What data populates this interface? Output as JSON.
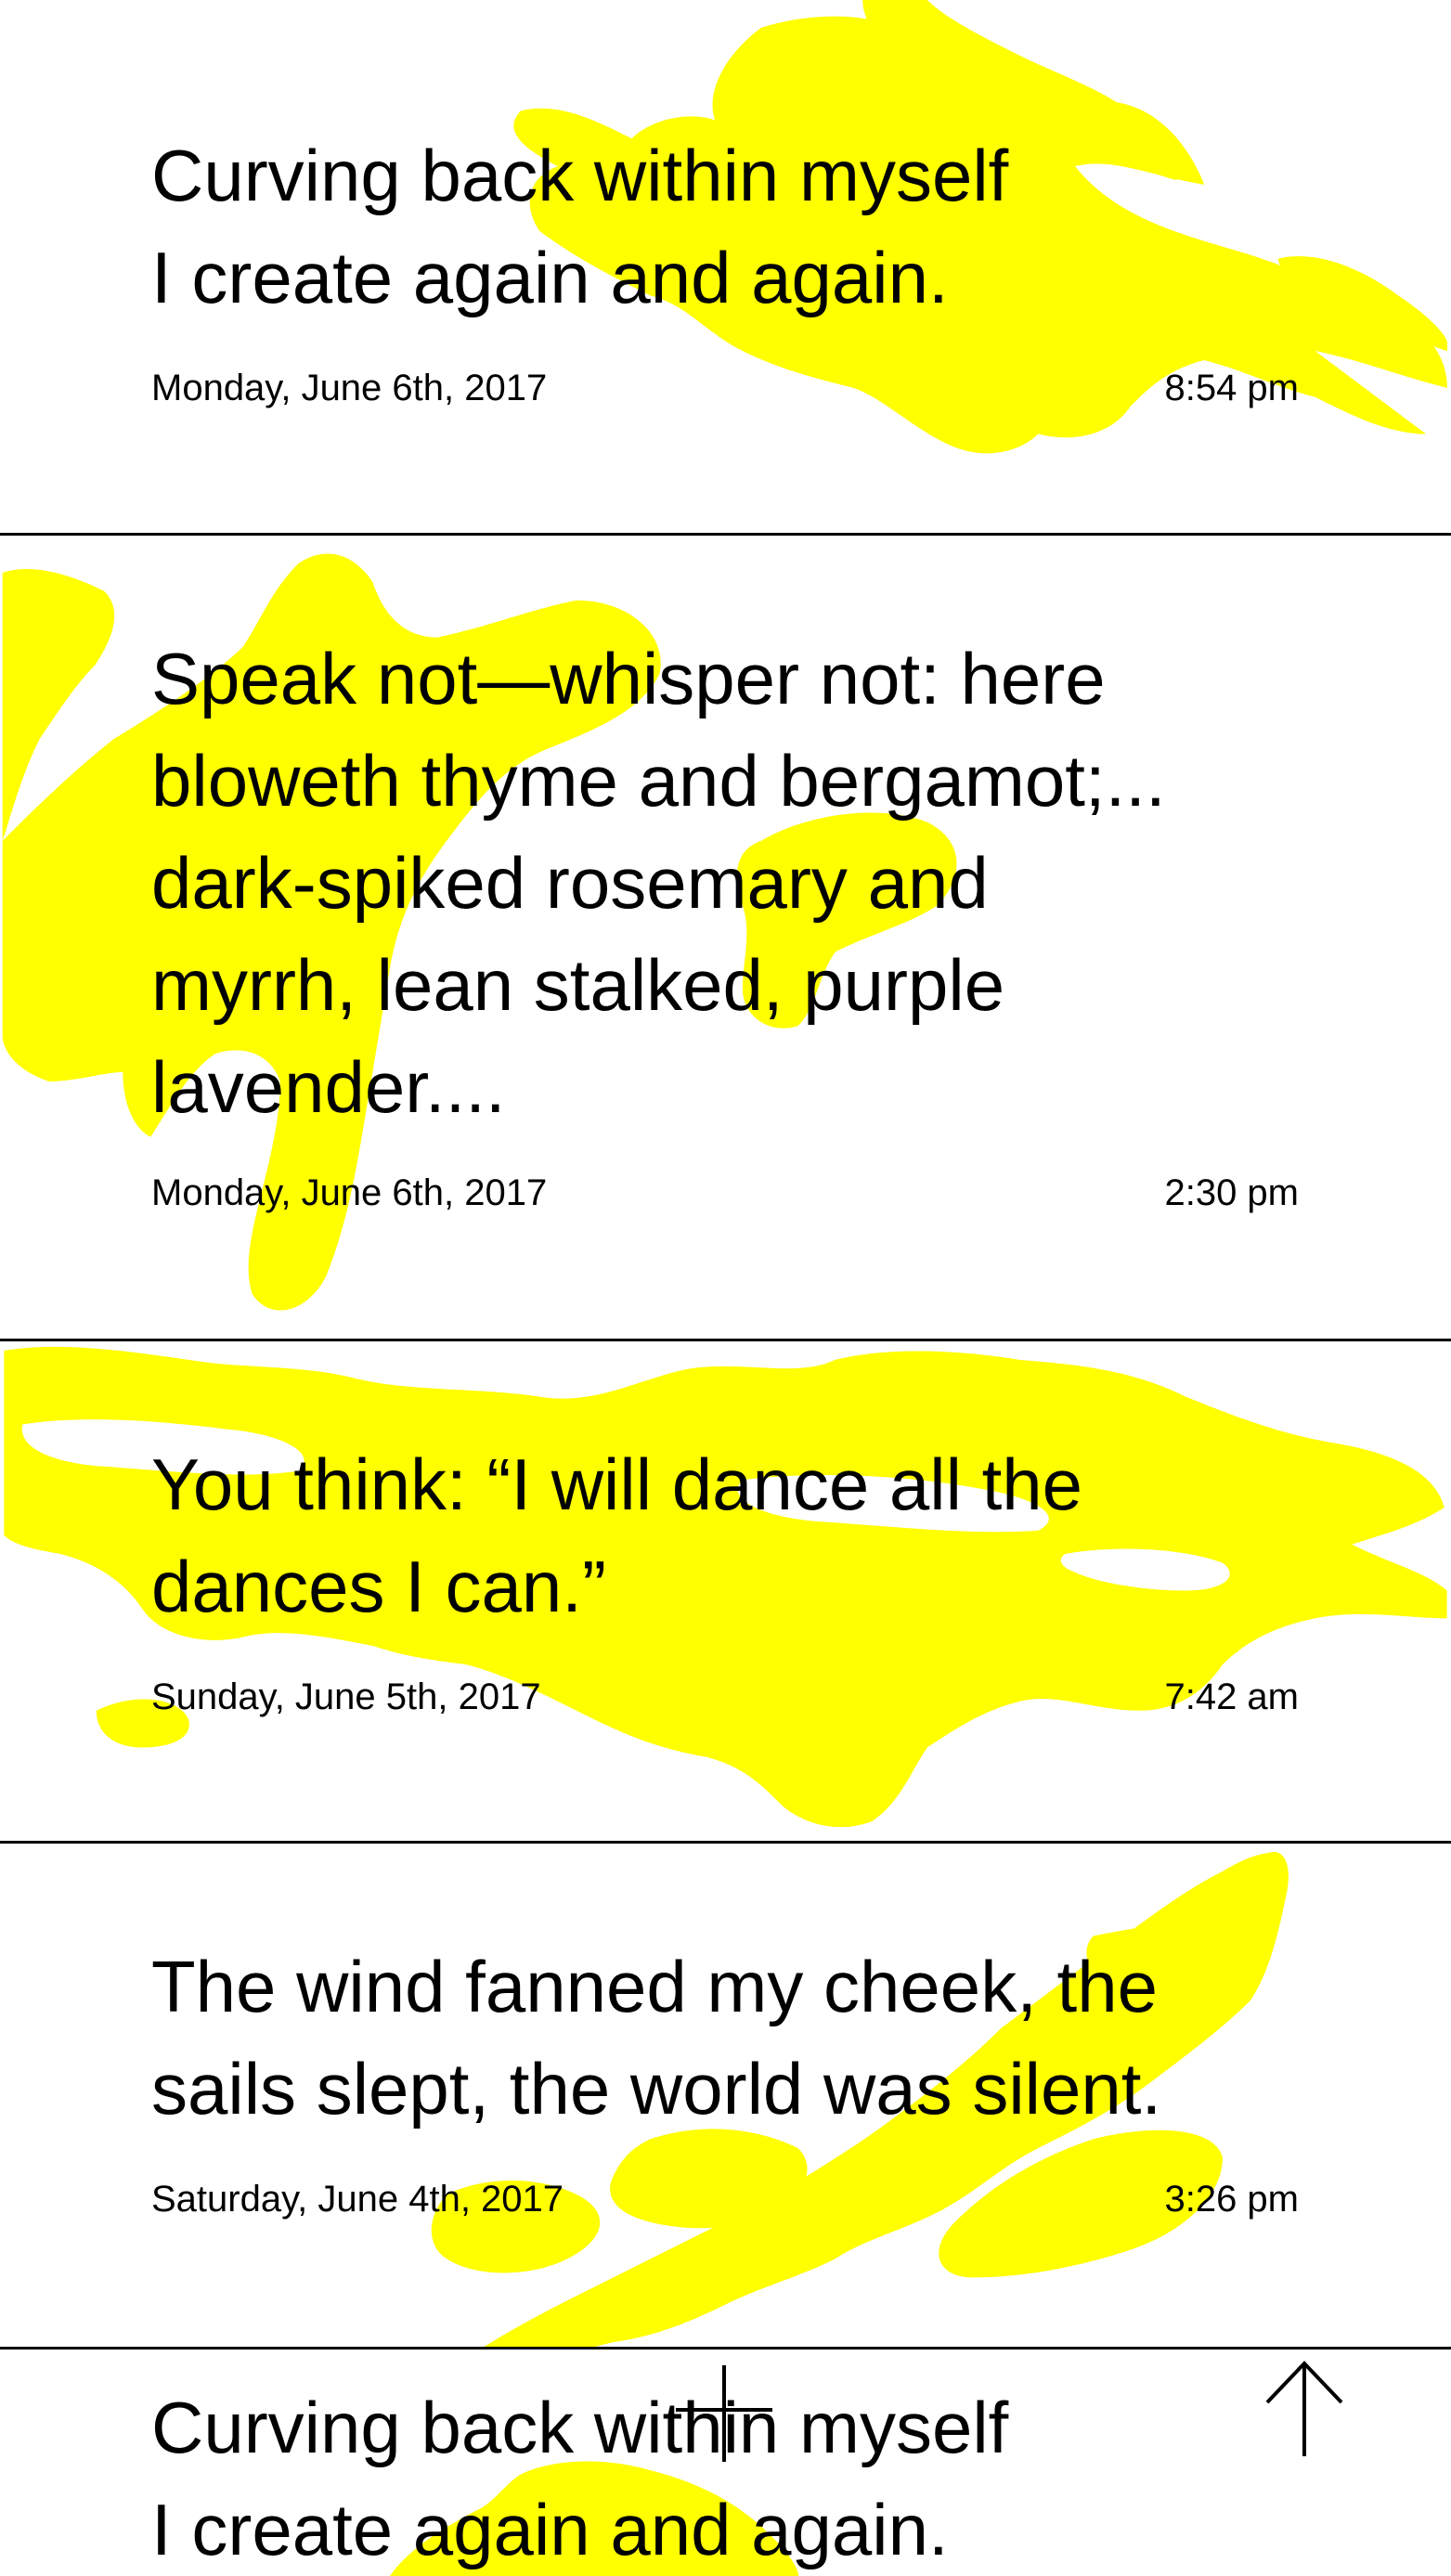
{
  "colors": {
    "highlight": "#ffff00",
    "text": "#000000",
    "background": "#ffffff",
    "divider": "#000000"
  },
  "entries": [
    {
      "text": "Curving back within myself\nI create again and again.",
      "date": "Monday, June 6th, 2017",
      "time": "8:54 pm"
    },
    {
      "text": "Speak not—whisper not: here\nbloweth thyme and bergamot;...\ndark-spiked rosemary and\nmyrrh, lean stalked, purple\nlavender....",
      "date": "Monday, June 6th, 2017",
      "time": "2:30 pm"
    },
    {
      "text": "You think: “I will dance all the\ndances I can.”",
      "date": "Sunday, June 5th, 2017",
      "time": "7:42 am"
    },
    {
      "text": "The wind fanned my cheek, the\nsails slept, the world was silent.",
      "date": "Saturday, June 4th, 2017",
      "time": "3:26 pm"
    },
    {
      "text": "Curving back within myself\nI create again and again."
    }
  ],
  "controls": {
    "add_icon": "plus-icon",
    "scroll_top_icon": "arrow-up-icon"
  }
}
